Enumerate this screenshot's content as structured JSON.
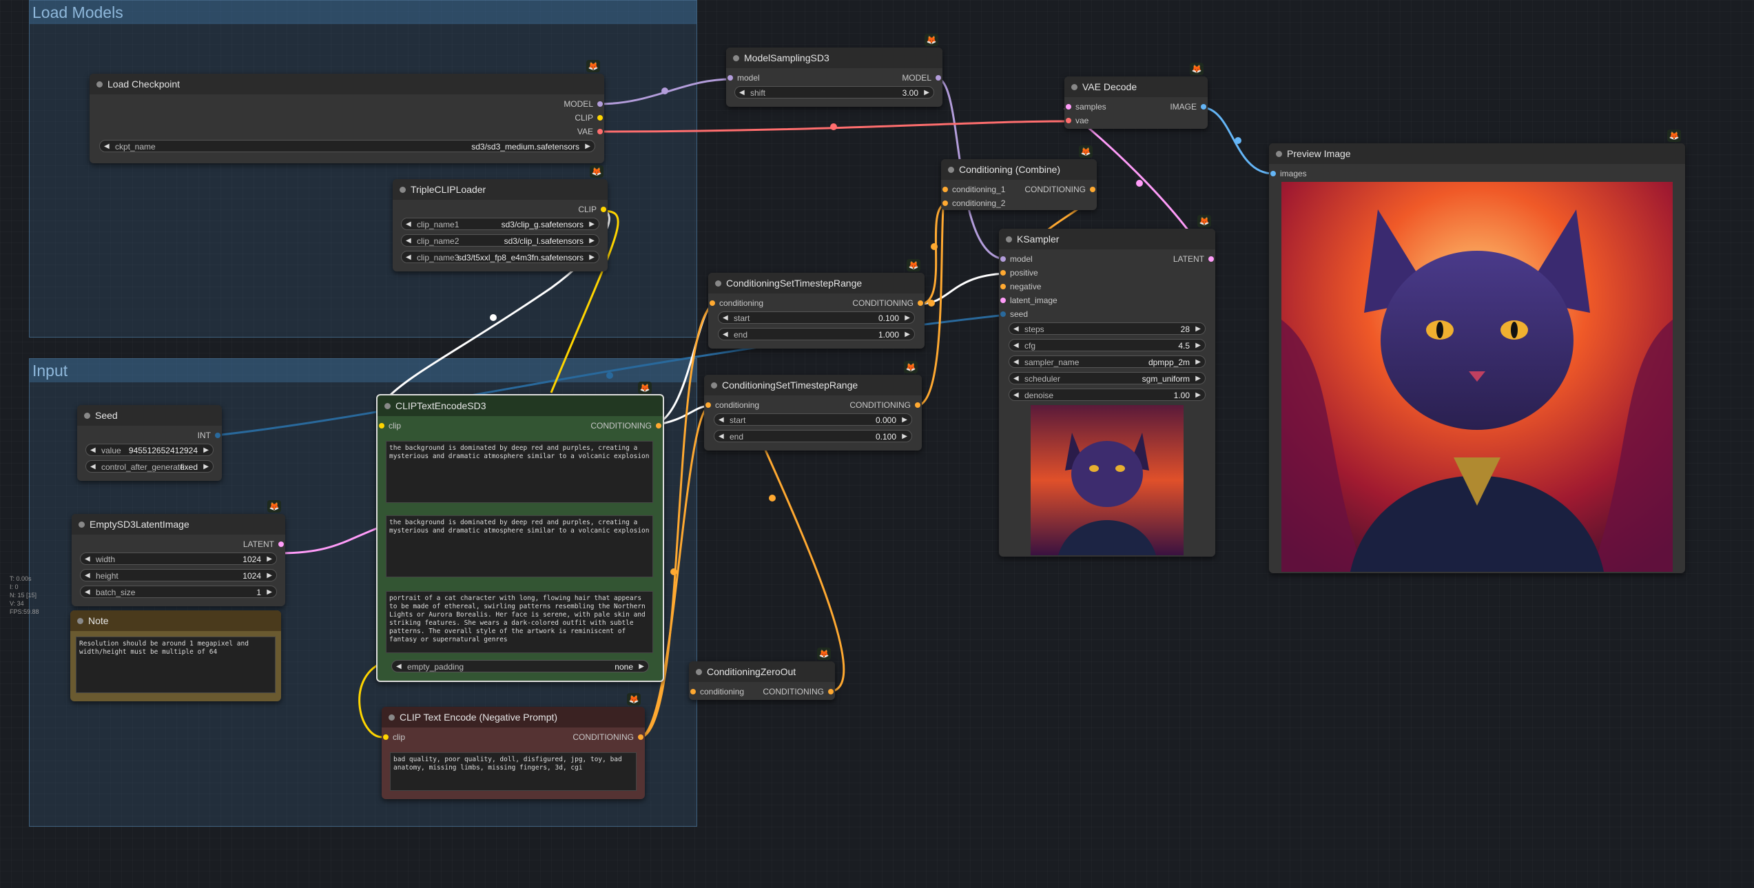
{
  "groups": {
    "load_models": "Load Models",
    "input": "Input"
  },
  "nodes": {
    "load_checkpoint": {
      "title": "Load Checkpoint",
      "out_model": "MODEL",
      "out_clip": "CLIP",
      "out_vae": "VAE",
      "ckpt_label": "ckpt_name",
      "ckpt_value": "sd3/sd3_medium.safetensors"
    },
    "triple_clip": {
      "title": "TripleCLIPLoader",
      "out_clip": "CLIP",
      "clip1_label": "clip_name1",
      "clip1_value": "sd3/clip_g.safetensors",
      "clip2_label": "clip_name2",
      "clip2_value": "sd3/clip_l.safetensors",
      "clip3_label": "clip_name3",
      "clip3_value": "sd3/t5xxl_fp8_e4m3fn.safetensors"
    },
    "model_sampling": {
      "title": "ModelSamplingSD3",
      "in_model": "model",
      "out_model": "MODEL",
      "shift_label": "shift",
      "shift_value": "3.00"
    },
    "vae_decode": {
      "title": "VAE Decode",
      "in_samples": "samples",
      "in_vae": "vae",
      "out_image": "IMAGE"
    },
    "cond_combine": {
      "title": "Conditioning (Combine)",
      "in_c1": "conditioning_1",
      "in_c2": "conditioning_2",
      "out": "CONDITIONING"
    },
    "ksampler": {
      "title": "KSampler",
      "in_model": "model",
      "in_positive": "positive",
      "in_negative": "negative",
      "in_latent": "latent_image",
      "in_seed": "seed",
      "out_latent": "LATENT",
      "steps_label": "steps",
      "steps_value": "28",
      "cfg_label": "cfg",
      "cfg_value": "4.5",
      "sampler_label": "sampler_name",
      "sampler_value": "dpmpp_2m",
      "scheduler_label": "scheduler",
      "scheduler_value": "sgm_uniform",
      "denoise_label": "denoise",
      "denoise_value": "1.00"
    },
    "preview": {
      "title": "Preview Image",
      "in_images": "images"
    },
    "cstr1": {
      "title": "ConditioningSetTimestepRange",
      "in": "conditioning",
      "out": "CONDITIONING",
      "start_label": "start",
      "start_value": "0.100",
      "end_label": "end",
      "end_value": "1.000"
    },
    "cstr2": {
      "title": "ConditioningSetTimestepRange",
      "in": "conditioning",
      "out": "CONDITIONING",
      "start_label": "start",
      "start_value": "0.000",
      "end_label": "end",
      "end_value": "0.100"
    },
    "seed": {
      "title": "Seed",
      "out_int": "INT",
      "value_label": "value",
      "value_value": "945512652412924",
      "cag_label": "control_after_generate",
      "cag_value": "fixed"
    },
    "empty_latent": {
      "title": "EmptySD3LatentImage",
      "out": "LATENT",
      "width_label": "width",
      "width_value": "1024",
      "height_label": "height",
      "height_value": "1024",
      "batch_label": "batch_size",
      "batch_value": "1"
    },
    "note": {
      "title": "Note",
      "text": "Resolution should be around 1 megapixel and width/height must be multiple of 64"
    },
    "clip_encode_sd3": {
      "title": "CLIPTextEncodeSD3",
      "in_clip": "clip",
      "out": "CONDITIONING",
      "text1": "the background is dominated by deep red and purples, creating a mysterious and dramatic atmosphere similar to a volcanic explosion",
      "text2": "the background is dominated by deep red and purples, creating a mysterious and dramatic atmosphere similar to a volcanic explosion",
      "text3": "portrait of a cat character with long, flowing hair that appears to be made of ethereal, swirling patterns resembling the Northern Lights or Aurora Borealis. Her face is serene, with pale skin and striking features. She wears a dark-colored outfit with subtle patterns. The overall style of the artwork is reminiscent of fantasy or supernatural genres",
      "pad_label": "empty_padding",
      "pad_value": "none"
    },
    "cond_zero": {
      "title": "ConditioningZeroOut",
      "in": "conditioning",
      "out": "CONDITIONING"
    },
    "clip_neg": {
      "title": "CLIP Text Encode (Negative Prompt)",
      "in_clip": "clip",
      "out": "CONDITIONING",
      "text": "bad quality, poor quality, doll, disfigured, jpg, toy, bad anatomy, missing limbs, missing fingers, 3d, cgi"
    }
  },
  "stats": {
    "t": "T: 0.00s",
    "i": "I: 0",
    "n": "N: 15 [15]",
    "v": "V: 34",
    "fps": "FPS:59.88"
  },
  "colors": {
    "model": "#b39ddb",
    "clip": "#ffd500",
    "vae": "#ff6e6e",
    "conditioning": "#ffa931",
    "latent": "#ff9cf9",
    "image": "#64b5f6",
    "int": "#29699c"
  },
  "icons": {
    "badge": "fox-icon"
  }
}
